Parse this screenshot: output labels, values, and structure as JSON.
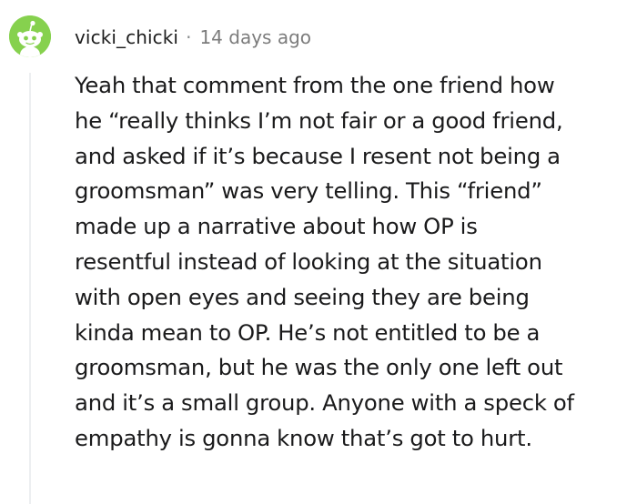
{
  "comment": {
    "author": "vicki_chicki",
    "separator": "·",
    "timestamp": "14 days ago",
    "avatar_color": "#86d14e",
    "lines": [
      "Yeah that comment from the one friend how",
      "he “really thinks I’m not fair or a good friend,",
      "and asked if it’s because I resent not being a",
      "groomsman” was very telling. This “friend”",
      "made up a narrative about how OP is",
      "resentful instead of looking at the situation",
      "with open eyes and seeing they are being",
      "kinda mean to OP. He’s not entitled to be a",
      "groomsman, but he was the only one left out",
      "and it’s a small group. Anyone with a speck of",
      "empathy is gonna know that’s got to hurt."
    ]
  }
}
